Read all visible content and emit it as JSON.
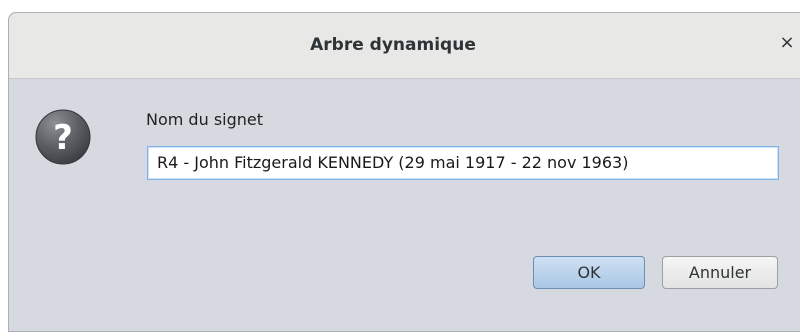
{
  "window": {
    "title": "Arbre dynamique",
    "close_symbol": "×"
  },
  "dialog": {
    "icon": "question-icon",
    "prompt": "Nom du signet",
    "input_value": "R4 - John Fitzgerald KENNEDY (29 mai 1917 - 22 nov 1963)"
  },
  "buttons": {
    "ok_label": "OK",
    "cancel_label": "Annuler"
  },
  "colors": {
    "dialog_background": "#d6d9df",
    "titlebar_background": "#e8e8e7",
    "input_focus_border": "#7eb4ea",
    "ok_button": "#b8d1eb"
  }
}
